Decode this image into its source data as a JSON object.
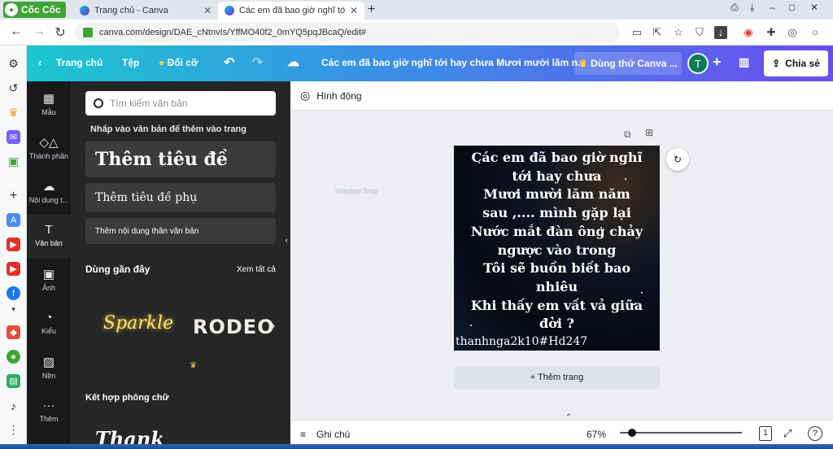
{
  "browser": {
    "brand": "Cốc Cốc",
    "tabs": [
      {
        "title": "Trang chủ - Canva",
        "active": false
      },
      {
        "title": "Các em đã bao giờ nghĩ tới h",
        "active": true
      }
    ],
    "url": "canva.com/design/DAE_cNtnvIs/YffMO40f2_0mYQ5pqJBcaQ/edit#",
    "window_controls": [
      "–",
      "□",
      "✕"
    ]
  },
  "canva_header": {
    "home": "Trang chủ",
    "file": "Tệp",
    "resize": "Đổi cỡ",
    "title": "Các em đã bao giờ nghĩ tới hay chưa Mươi mười lăm n...",
    "try_pro": "Dùng thử Canva ...",
    "avatar_letter": "T",
    "share": "Chia sẻ"
  },
  "rail": [
    {
      "icon": "▦",
      "label": "Mẫu"
    },
    {
      "icon": "◇△",
      "label": "Thành phần"
    },
    {
      "icon": "☁",
      "label": "Nội dung t..."
    },
    {
      "icon": "T",
      "label": "Văn bản"
    },
    {
      "icon": "▣",
      "label": "Ảnh"
    },
    {
      "icon": "◔",
      "label": "Kiểu"
    },
    {
      "icon": "▨",
      "label": "Nền"
    },
    {
      "icon": "···",
      "label": "Thêm"
    }
  ],
  "panel": {
    "search_placeholder": "Tìm kiếm văn bản",
    "hint": "Nhấp vào văn bản để thêm vào trang",
    "heading": "Thêm tiêu đề",
    "subheading": "Thêm tiêu đề phụ",
    "body": "Thêm nội dung thân văn bản",
    "recent": "Dùng gần đây",
    "see_all": "Xem tất cả",
    "font_sample_1": "Sparkle",
    "font_sample_2": "RODEO",
    "combos": "Kết hợp phông chữ",
    "combo_sample": "Thank"
  },
  "workspace": {
    "animate": "Hình động",
    "snip_ghost": "Window Snip",
    "poem_lines": [
      "Các em đã bao giờ nghĩ",
      "tới hay chưa",
      "Mươi mười lăm năm",
      "sau ,.... mình gặp lại",
      "Nước mắt đàn ông chảy",
      "ngược vào trong",
      "Tôi sẽ buồn biết bao",
      "nhiêu",
      "Khi thấy em vất vả giữa",
      "đời ?"
    ],
    "signature": "thanhnga2k10#Hd247",
    "add_page": "+ Thêm trang"
  },
  "bottom_bar": {
    "notes": "Ghi chú",
    "zoom": "67%",
    "zoom_fraction": 0.1,
    "page_num": "1"
  },
  "colors": {
    "brand_green": "#3fa535",
    "canva_gradient_start": "#1cc7cf",
    "canva_gradient_end": "#6c4df0",
    "dark_panel": "#252627"
  }
}
